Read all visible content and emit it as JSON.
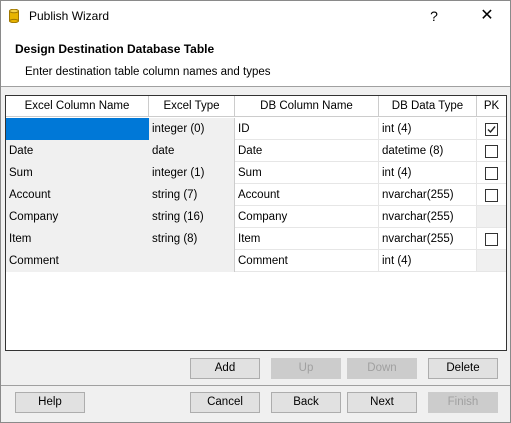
{
  "window": {
    "title": "Publish Wizard",
    "help_glyph": "?",
    "close_glyph": "✕"
  },
  "header": {
    "title": "Design Destination Database Table",
    "subtitle": "Enter destination table column names and types"
  },
  "grid": {
    "columns": [
      "Excel Column Name",
      "Excel Type",
      "DB Column Name",
      "DB Data Type",
      "PK"
    ],
    "rows": [
      {
        "excel_name": "",
        "excel_type": "integer (0)",
        "db_name": "ID",
        "db_type": "int (4)",
        "pk": true,
        "pk_visible": true
      },
      {
        "excel_name": "Date",
        "excel_type": "date",
        "db_name": "Date",
        "db_type": "datetime (8)",
        "pk": false,
        "pk_visible": true
      },
      {
        "excel_name": "Sum",
        "excel_type": "integer (1)",
        "db_name": "Sum",
        "db_type": "int (4)",
        "pk": false,
        "pk_visible": true
      },
      {
        "excel_name": "Account",
        "excel_type": "string (7)",
        "db_name": "Account",
        "db_type": "nvarchar(255)",
        "pk": false,
        "pk_visible": true
      },
      {
        "excel_name": "Company",
        "excel_type": "string (16)",
        "db_name": "Company",
        "db_type": "nvarchar(255)",
        "pk": false,
        "pk_visible": false
      },
      {
        "excel_name": "Item",
        "excel_type": "string (8)",
        "db_name": "Item",
        "db_type": "nvarchar(255)",
        "pk": false,
        "pk_visible": true
      },
      {
        "excel_name": "Comment",
        "excel_type": "",
        "db_name": "Comment",
        "db_type": "int (4)",
        "pk": false,
        "pk_visible": false
      }
    ]
  },
  "row_buttons": {
    "add": "Add",
    "up": "Up",
    "down": "Down",
    "delete": "Delete"
  },
  "nav_buttons": {
    "help": "Help",
    "cancel": "Cancel",
    "back": "Back",
    "next": "Next",
    "finish": "Finish"
  },
  "colors": {
    "selection": "#0078d7",
    "dialog_bg": "#f0f0f0",
    "icon_yellow": "#e8b400"
  }
}
